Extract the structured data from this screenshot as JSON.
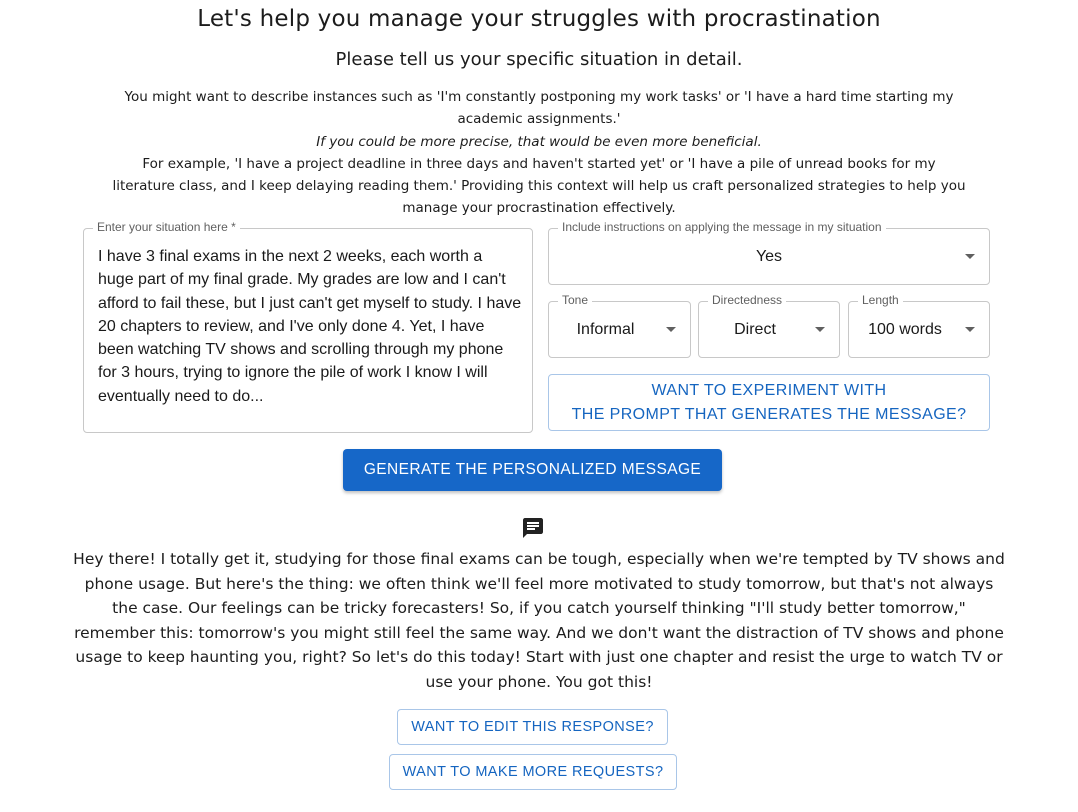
{
  "header": {
    "title": "Let's help you manage your struggles with procrastination",
    "subtitle": "Please tell us your specific situation in detail."
  },
  "intro": {
    "line1": "You might want to describe instances such as 'I'm constantly postponing my work tasks' or 'I have a hard time starting my academic assignments.'",
    "line2": "If you could be more precise, that would be even more beneficial.",
    "line3": "For example, 'I have a project deadline in three days and haven't started yet' or 'I have a pile of unread books for my literature class, and I keep delaying reading them.' Providing this context will help us craft personalized strategies to help you manage your procrastination effectively."
  },
  "situation_field": {
    "label": "Enter your situation here *",
    "value": "I have 3 final exams in the next 2 weeks, each worth a huge part of my final grade. My grades are low and I can't afford to fail these, but I just can't get myself to study. I have 20 chapters to review, and I've only done 4. Yet, I have been watching TV shows and scrolling through my phone for 3 hours, trying to ignore the pile of work I know I will eventually need to do..."
  },
  "selects": {
    "instructions": {
      "label": "Include instructions on applying the message in my situation",
      "value": "Yes"
    },
    "tone": {
      "label": "Tone",
      "value": "Informal"
    },
    "directedness": {
      "label": "Directedness",
      "value": "Direct"
    },
    "length": {
      "label": "Length",
      "value": "100 words"
    }
  },
  "buttons": {
    "prompt_line1": "WANT TO EXPERIMENT WITH",
    "prompt_line2": "THE PROMPT THAT GENERATES THE MESSAGE?",
    "generate": "GENERATE THE PERSONALIZED MESSAGE",
    "edit": "WANT TO EDIT THIS RESPONSE?",
    "more": "WANT TO MAKE MORE REQUESTS?"
  },
  "response": {
    "icon": "message-icon",
    "text": "Hey there! I totally get it, studying for those final exams can be tough, especially when we're tempted by TV shows and phone usage. But here's the thing: we often think we'll feel more motivated to study tomorrow, but that's not always the case. Our feelings can be tricky forecasters! So, if you catch yourself thinking \"I'll study better tomorrow,\" remember this: tomorrow's you might still feel the same way. And we don't want the distraction of TV shows and phone usage to keep haunting you, right? So let's do this today! Start with just one chapter and resist the urge to watch TV or use your phone. You got this!"
  },
  "colors": {
    "primary": "#1667c8",
    "outline_text": "#1565c0",
    "border": "#c8c8c8"
  }
}
